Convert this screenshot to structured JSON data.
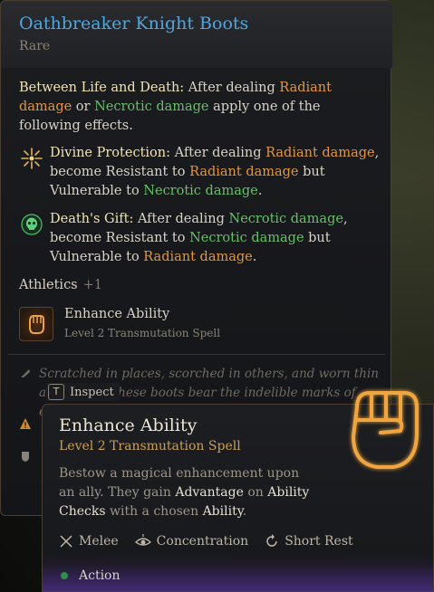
{
  "item": {
    "name": "Oathbreaker Knight Boots",
    "rarity": "Rare",
    "main_effect": {
      "name": "Between Life and Death:",
      "text1": "After dealing",
      "radiant": "Radiant damage",
      "text2": "or",
      "necrotic": "Necrotic damage",
      "text3": "apply one of the following effects."
    },
    "effects": [
      {
        "icon": "sunburst-icon",
        "name": "Divine Protection:",
        "t1": "After dealing",
        "d1": "Radiant damage",
        "t2": ", become Resistant to",
        "d2": "Radiant damage",
        "t3": "but Vulnerable to",
        "d3": "Necrotic damage",
        "t4": "."
      },
      {
        "icon": "skull-icon",
        "name": "Death's Gift:",
        "t1": "After dealing",
        "d1": "Necrotic damage",
        "t2": ", become Resistant to",
        "d2": "Necrotic damage",
        "t3": "but Vulnerable to",
        "d3": "Radiant damage",
        "t4": "."
      }
    ],
    "skill": {
      "name": "Athletics",
      "bonus": "+1"
    },
    "spell": {
      "name": "Enhance Ability",
      "level": "Level 2 Transmutation Spell"
    },
    "flavor": "Scratched in places, scorched in others, and worn thin at the heel, these boots bear the indelible marks of experience.",
    "inspect": {
      "key": "T",
      "label": "Inspect"
    }
  },
  "tooltip": {
    "title": "Enhance Ability",
    "subtitle": "Level 2 Transmutation Spell",
    "desc": {
      "a": "Bestow a magical enhancement upon an ally. They gain",
      "b": "Advantage",
      "c": "on",
      "d": "Ability Checks",
      "e": "with a chosen",
      "f": "Ability",
      "g": "."
    },
    "props": [
      {
        "icon": "crossed-swords-icon",
        "label": "Melee"
      },
      {
        "icon": "concentration-eye-icon",
        "label": "Concentration"
      },
      {
        "icon": "short-rest-icon",
        "label": "Short Rest"
      }
    ],
    "action": "Action"
  },
  "colors": {
    "title_blue": "#4ea8e0",
    "radiant": "#e2963e",
    "necrotic": "#66c06a",
    "gold": "#c9a055",
    "action_dot": "#2f8f4a"
  }
}
